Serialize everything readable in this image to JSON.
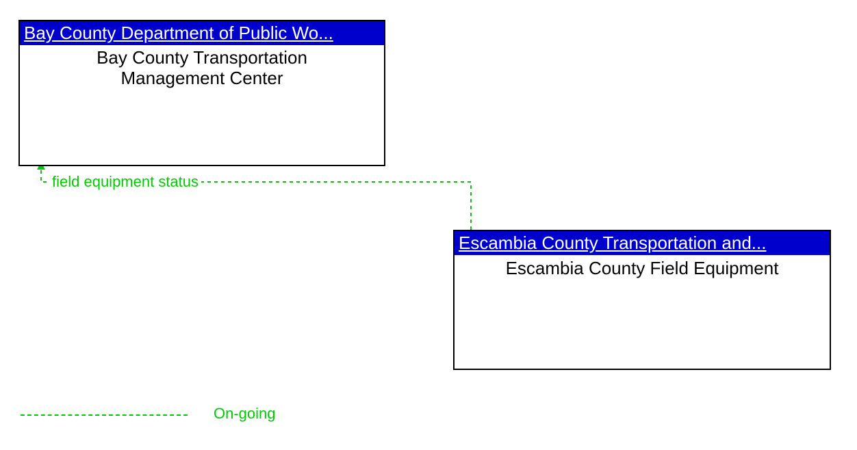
{
  "boxes": {
    "box1": {
      "header": "Bay County Department of Public Wo...",
      "body_line1": "Bay County Transportation",
      "body_line2": "Management Center"
    },
    "box2": {
      "header": "Escambia County Transportation and...",
      "body": "Escambia County Field Equipment"
    }
  },
  "flows": {
    "flow1": {
      "label": "field equipment status"
    }
  },
  "legend": {
    "ongoing": "On-going"
  },
  "colors": {
    "header_bg": "#0000CC",
    "flow_color": "#00CC00"
  }
}
